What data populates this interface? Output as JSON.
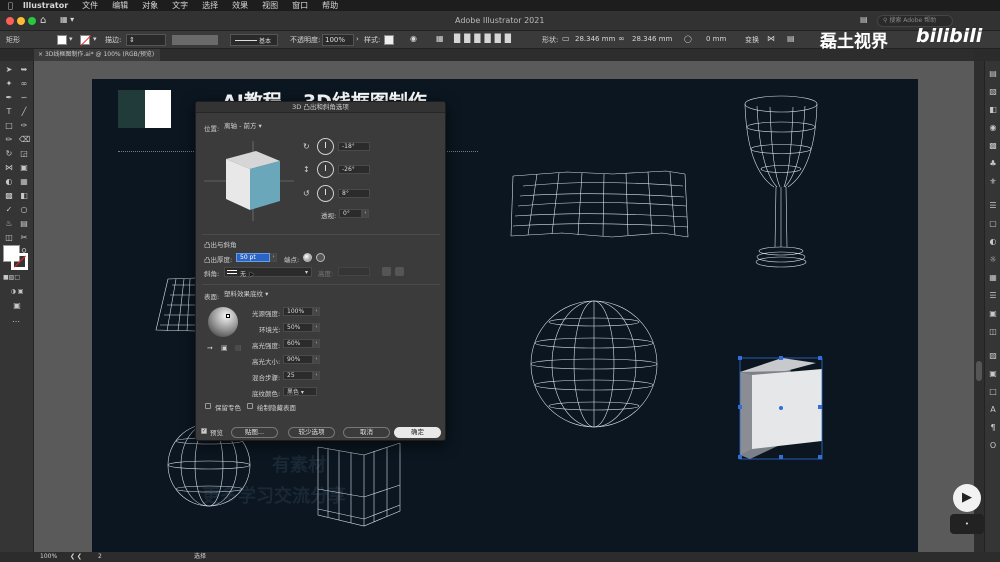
{
  "menubar": {
    "app": "Illustrator",
    "items": [
      "文件",
      "编辑",
      "对象",
      "文字",
      "选择",
      "效果",
      "视图",
      "窗口",
      "帮助"
    ]
  },
  "window": {
    "title": "Adobe Illustrator 2021",
    "search_placeholder": "搜索 Adobe 帮助"
  },
  "controlbar": {
    "selection_label": "矩形",
    "stroke_label": "描边:",
    "stroke_style": "基本",
    "opacity_label": "不透明度:",
    "opacity_value": "100%",
    "style_label": "样式:",
    "shape_label": "形状:",
    "width_value": "28.346 mm",
    "height_value": "28.346 mm",
    "corner_value": "0 mm",
    "transform_label": "变换"
  },
  "document": {
    "tab_label": "3D线框图制作.ai* @ 100% (RGB/预览)"
  },
  "artboard": {
    "heading": "AI教程 - 3D线框图制作",
    "faded_line1": "有素材",
    "faded_line2": "更多学习交流分享"
  },
  "watermark": {
    "channel": "磊土视界",
    "brand": "bilibili"
  },
  "statusbar": {
    "zoom": "100%",
    "artboard_number": "2",
    "tool": "选择"
  },
  "dialog": {
    "title": "3D 凸出和斜角选项",
    "position_label": "位置:",
    "position_value": "离轴 - 前方",
    "rot_x": "-18°",
    "rot_y": "-26°",
    "rot_z": "8°",
    "perspective_label": "透视:",
    "perspective_value": "0°",
    "extrude_section": "凸出与斜角",
    "extrude_depth_label": "凸出厚度:",
    "extrude_depth_value": "50 pt",
    "cap_label": "端点:",
    "bevel_label": "斜角:",
    "bevel_value": "无",
    "height_label": "高度:",
    "surface_label": "表面:",
    "surface_value": "塑料效果底纹",
    "light_intensity_label": "光源强度:",
    "light_intensity_value": "100%",
    "ambient_label": "环境光:",
    "ambient_value": "50%",
    "highlight_intensity_label": "高光强度:",
    "highlight_intensity_value": "60%",
    "highlight_size_label": "高光大小:",
    "highlight_size_value": "90%",
    "blend_steps_label": "混合步骤:",
    "blend_steps_value": "25",
    "shading_color_label": "底纹颜色:",
    "shading_color_value": "黑色",
    "preserve_spot_label": "保留专色",
    "draw_hidden_label": "绘制隐藏表面",
    "preview_label": "预览",
    "map_button": "贴图...",
    "fewer_options_button": "较少选项",
    "cancel_button": "取消",
    "ok_button": "确定"
  },
  "colors": {
    "artboard_bg": "#0b1620",
    "swatch_dark": "#213b3a",
    "cube_face": "#6aa7bb",
    "accent_blue": "#2f6fd6"
  }
}
